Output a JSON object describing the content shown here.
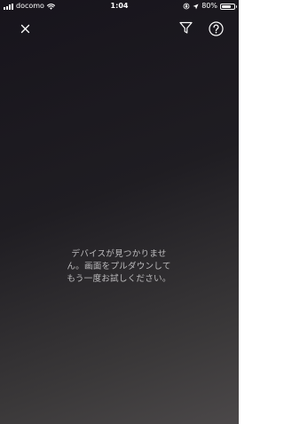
{
  "status_bar": {
    "carrier": "docomo",
    "time": "1:04",
    "battery_percent": "80%",
    "battery_level": 0.8
  },
  "toolbar": {
    "close_icon": "close-icon",
    "filter_icon": "filter-icon",
    "help_icon": "help-icon"
  },
  "main": {
    "empty_message_lines": [
      "デバイスが見つかりませ",
      "ん。画面をプルダウンして",
      "もう一度お試しください。"
    ]
  },
  "colors": {
    "background_top": "#17141c",
    "background_bottom": "#4b4849",
    "text_secondary": "#bdbcbe",
    "icon": "#ffffff"
  }
}
